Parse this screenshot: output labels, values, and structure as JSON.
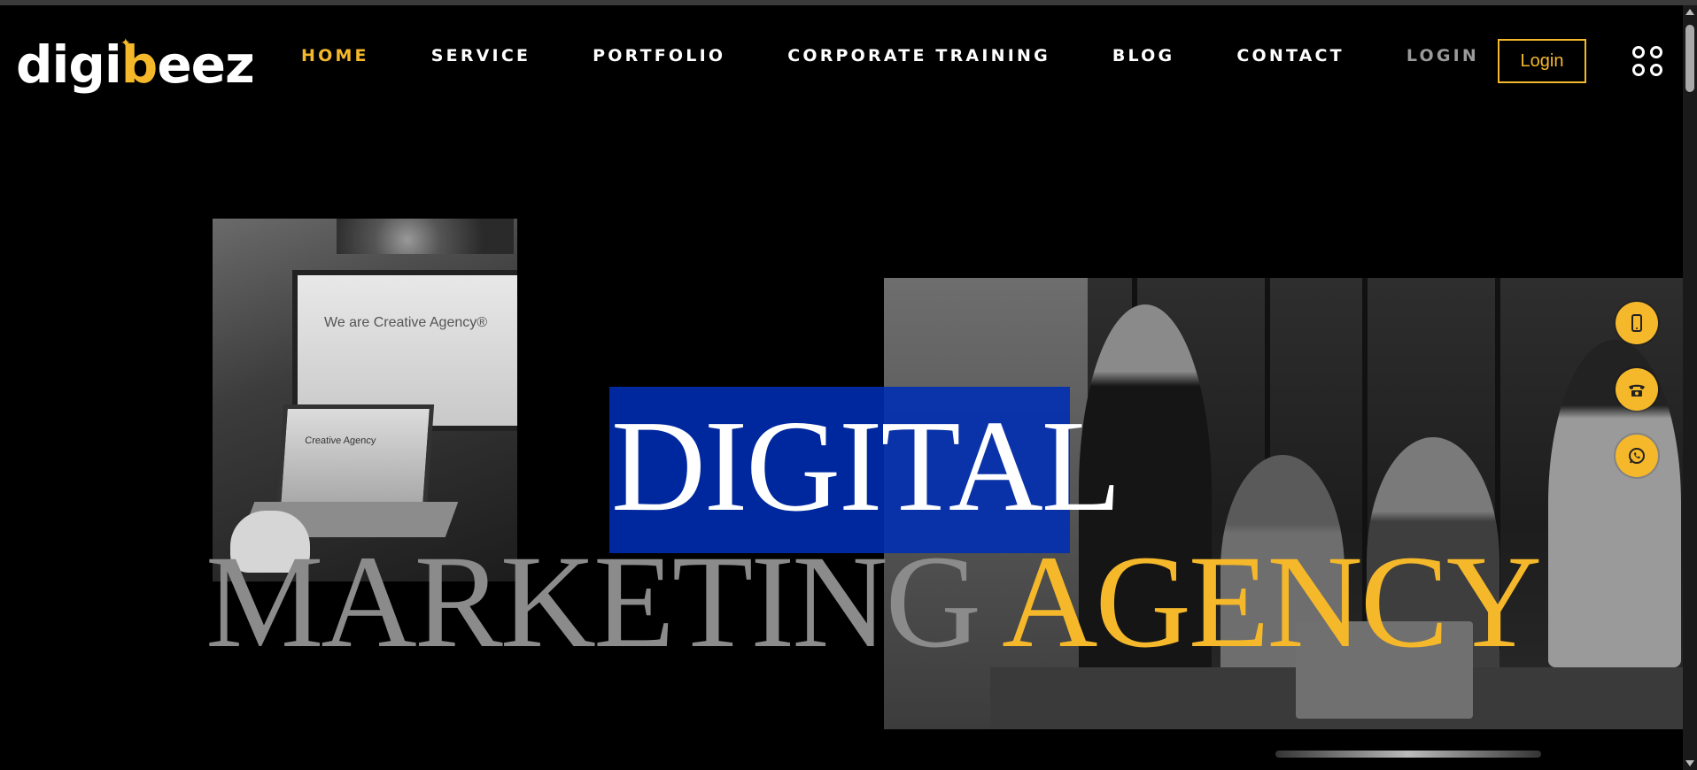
{
  "header": {
    "logo": {
      "prefix": "digi",
      "accent": "b",
      "suffix": "eez"
    },
    "nav": [
      {
        "label": "HOME",
        "state": "active"
      },
      {
        "label": "SERVICE"
      },
      {
        "label": "PORTFOLIO"
      },
      {
        "label": "CORPORATE TRAINING"
      },
      {
        "label": "BLOG"
      },
      {
        "label": "CONTACT"
      },
      {
        "label": "LOGIN",
        "state": "muted"
      }
    ],
    "login_button": "Login",
    "menu_icon": "grid-menu-icon"
  },
  "hero": {
    "line1": "DIGITAL",
    "line2_part1": "MARKETING",
    "line2_part2": "AGENCY",
    "left_image_text": {
      "monitor": "We are Creative Agency®",
      "laptop": "Creative Agency"
    }
  },
  "floating_contacts": [
    {
      "icon": "mobile-phone-icon"
    },
    {
      "icon": "telephone-icon"
    },
    {
      "icon": "whatsapp-icon"
    }
  ],
  "colors": {
    "accent": "#f5b82a",
    "background": "#000000",
    "overlay": "#002eb4",
    "muted_text": "#8b8b8b"
  }
}
